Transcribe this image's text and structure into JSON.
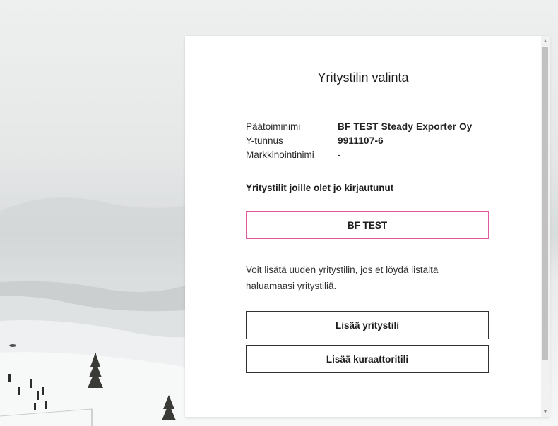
{
  "dialog": {
    "title": "Yritystilin valinta",
    "company": {
      "name_label": "Päätoiminimi",
      "name_value": "BF TEST Steady Exporter Oy",
      "id_label": "Y-tunnus",
      "id_value": "9911107-6",
      "marketing_label": "Markkinointinimi",
      "marketing_value": "-"
    },
    "logged_in_heading": "Yritystilit joille olet jo kirjautunut",
    "accounts": [
      "BF TEST"
    ],
    "add_description": "Voit lisätä uuden yritystilin, jos et löydä listalta haluamaasi yritystiliä.",
    "add_company_button": "Lisää yritystili",
    "add_curator_button": "Lisää kuraattoritili"
  },
  "colors": {
    "accent_border": "#e05aa1",
    "text": "#1d1d1d"
  },
  "icons": {
    "scroll_up": "triangle-up",
    "scroll_down": "triangle-down"
  }
}
